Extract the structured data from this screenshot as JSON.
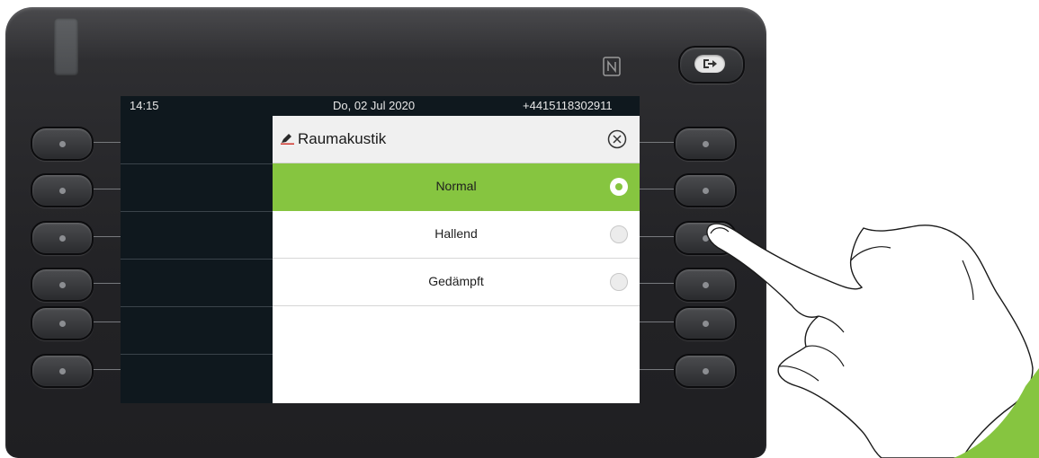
{
  "status_bar": {
    "time": "14:15",
    "date": "Do, 02 Jul 2020",
    "number": "+4415118302911"
  },
  "dialog": {
    "title": "Raumakustik",
    "title_icon": "pencil-icon",
    "close_icon": "close-circle-icon",
    "options": [
      {
        "label": "Normal",
        "selected": true
      },
      {
        "label": "Hallend",
        "selected": false
      },
      {
        "label": "Gedämpft",
        "selected": false
      }
    ]
  },
  "colors": {
    "accent": "#86c540",
    "screen_bg": "#0f181e",
    "phone_body": "#232326"
  },
  "icons": {
    "nfc": "nfc-icon",
    "logout": "logout-icon"
  }
}
